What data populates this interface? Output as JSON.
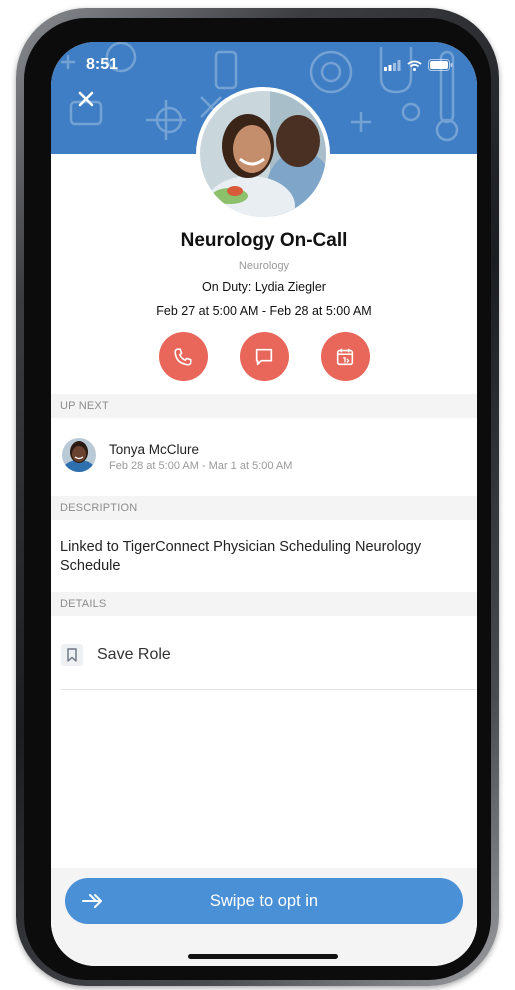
{
  "status": {
    "time": "8:51"
  },
  "role": {
    "title": "Neurology On-Call",
    "department": "Neurology",
    "on_duty": "On Duty: Lydia Ziegler",
    "range": "Feb 27 at 5:00 AM - Feb 28 at 5:00 AM"
  },
  "actions": [
    {
      "icon": "phone-icon"
    },
    {
      "icon": "message-icon"
    },
    {
      "icon": "calendar-icon"
    }
  ],
  "up_next": {
    "header": "UP NEXT",
    "name": "Tonya McClure",
    "time": "Feb 28 at 5:00 AM - Mar 1 at 5:00 AM"
  },
  "description": {
    "header": "DESCRIPTION",
    "text": "Linked to TigerConnect Physician Scheduling Neurology Schedule"
  },
  "details": {
    "header": "DETAILS",
    "save_label": "Save Role"
  },
  "swipe": {
    "label": "Swipe to opt in"
  },
  "colors": {
    "banner": "#3f7ec4",
    "action": "#e8675a",
    "swipe": "#4a90d6"
  }
}
